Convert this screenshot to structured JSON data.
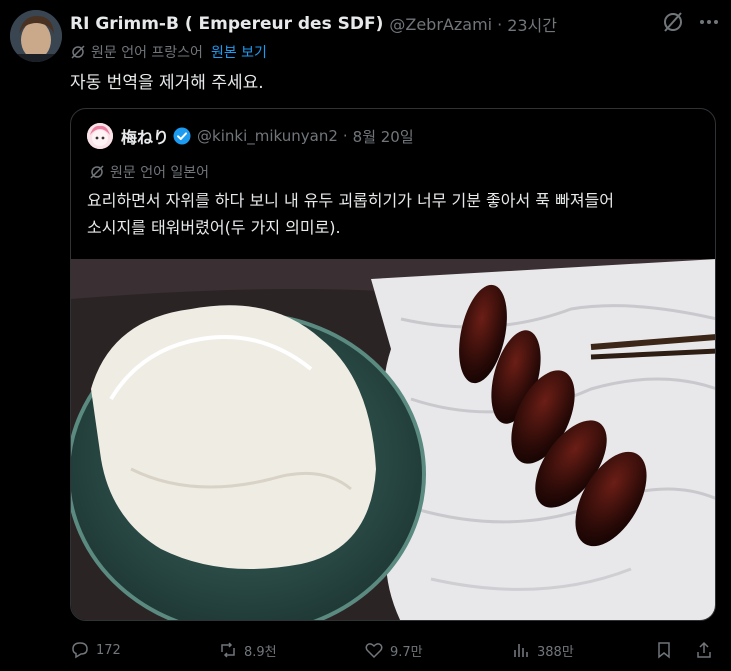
{
  "tweet": {
    "display_name": "RI Grimm-B ( Empereur des SDF)",
    "handle": "@ZebrAzami",
    "separator": "·",
    "time": "23시간",
    "translation_note": "원문 언어 프랑스어",
    "view_original": "원본 보기",
    "text": "자동 번역을 제거해 주세요."
  },
  "quoted": {
    "display_name": "梅ねり",
    "handle": "@kinki_mikunyan2",
    "separator": "·",
    "date": "8월 20일",
    "translation_note": "원문 언어 일본어",
    "text_line1": "요리하면서 자위를 하다 보니 내 유두 괴롭히기가 너무 기분 좋아서 푹 빠져들어",
    "text_line2": "소시지를 태워버렸어(두 가지 의미로)."
  },
  "actions": {
    "replies": "172",
    "reposts": "8.9천",
    "likes": "9.7만",
    "views": "388만"
  },
  "colors": {
    "background": "#000000",
    "text": "#e7e9ea",
    "muted": "#71767b",
    "accent": "#1d9bf0",
    "border": "#2f3336"
  },
  "icons": [
    "grok-icon",
    "more-icon",
    "translate-icon",
    "verified-badge-icon",
    "reply-icon",
    "repost-icon",
    "like-icon",
    "views-icon",
    "bookmark-icon",
    "share-icon"
  ]
}
